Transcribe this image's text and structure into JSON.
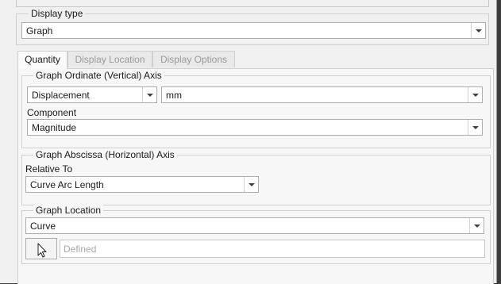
{
  "display_type": {
    "title": "Display type",
    "value": "Graph"
  },
  "tabs": [
    {
      "label": "Quantity",
      "active": true
    },
    {
      "label": "Display Location",
      "active": false
    },
    {
      "label": "Display Options",
      "active": false
    }
  ],
  "ordinate": {
    "title": "Graph Ordinate (Vertical) Axis",
    "quantity_value": "Displacement",
    "unit_value": "mm",
    "component_label": "Component",
    "component_value": "Magnitude"
  },
  "abscissa": {
    "title": "Graph Abscissa (Horizontal) Axis",
    "relative_label": "Relative To",
    "relative_value": "Curve Arc Length"
  },
  "location": {
    "title": "Graph Location",
    "type_value": "Curve",
    "selector_icon": "cursor-arrow-icon",
    "defined_placeholder": "Defined"
  }
}
